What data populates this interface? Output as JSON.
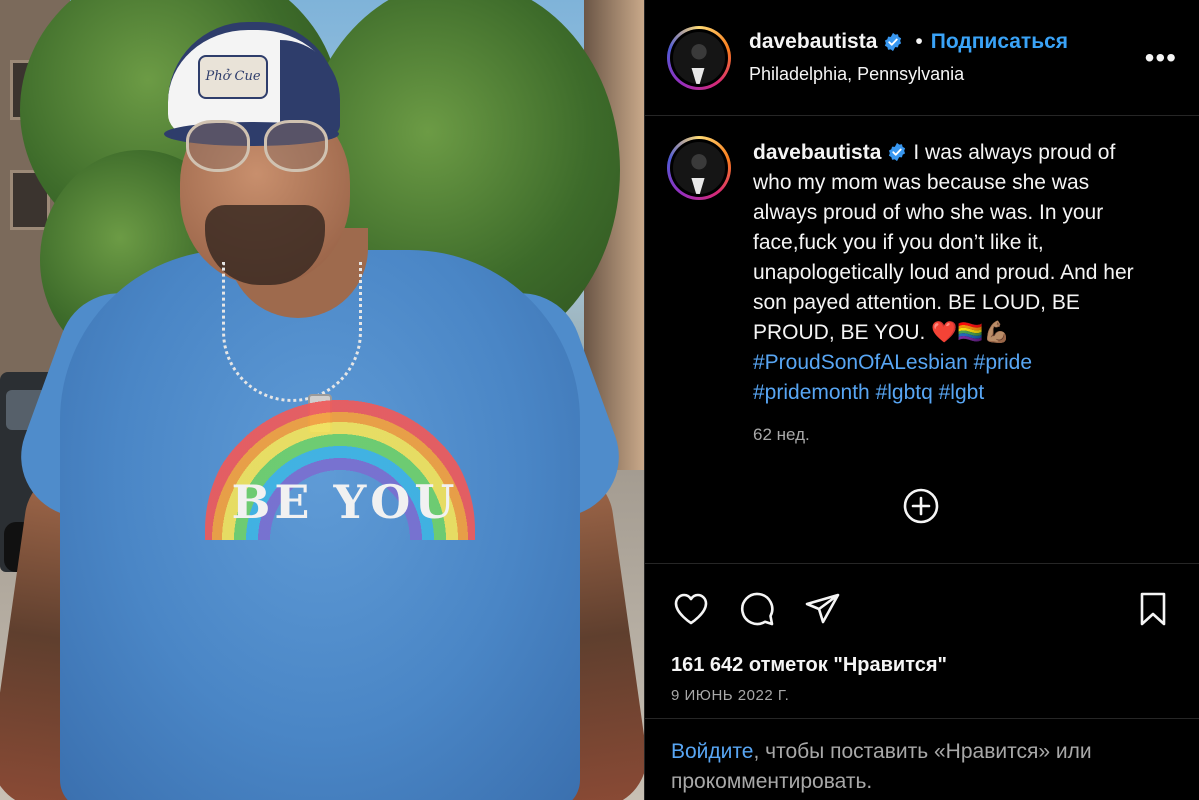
{
  "post": {
    "username": "davebautista",
    "follow_label": "Подписаться",
    "separator": "•",
    "location": "Philadelphia, Pennsylvania",
    "more_label": "•••",
    "photo": {
      "cap_text": "Phở Cue",
      "shirt_text": "BE YOU"
    }
  },
  "caption": {
    "username": "davebautista",
    "text": "I was always proud of who my mom was because she was always proud of who she was. In your face,fuck you if you don’t like it, unapologetically loud and proud. And her son payed attention. BE LOUD, BE PROUD, BE YOU. ❤️🏳️‍🌈💪🏽",
    "hashtags": "#ProudSonOfALesbian #pride #pridemonth #lgbtq #lgbt",
    "time": "62 нед."
  },
  "stats": {
    "likes": "161 642 отметок \"Нравится\"",
    "date": "9 ИЮНЬ 2022 Г."
  },
  "login_prompt": {
    "link": "Войдите",
    "rest": ", чтобы поставить «Нравится» или прокомментировать."
  },
  "colors": {
    "accent": "#3aa3f7",
    "link": "#58a6f4",
    "muted": "#a8a8a8",
    "background": "#000000"
  },
  "icons": [
    "verified-badge-icon",
    "more-options-icon",
    "add-comment-icon",
    "heart-icon",
    "comment-icon",
    "share-icon",
    "bookmark-icon"
  ]
}
